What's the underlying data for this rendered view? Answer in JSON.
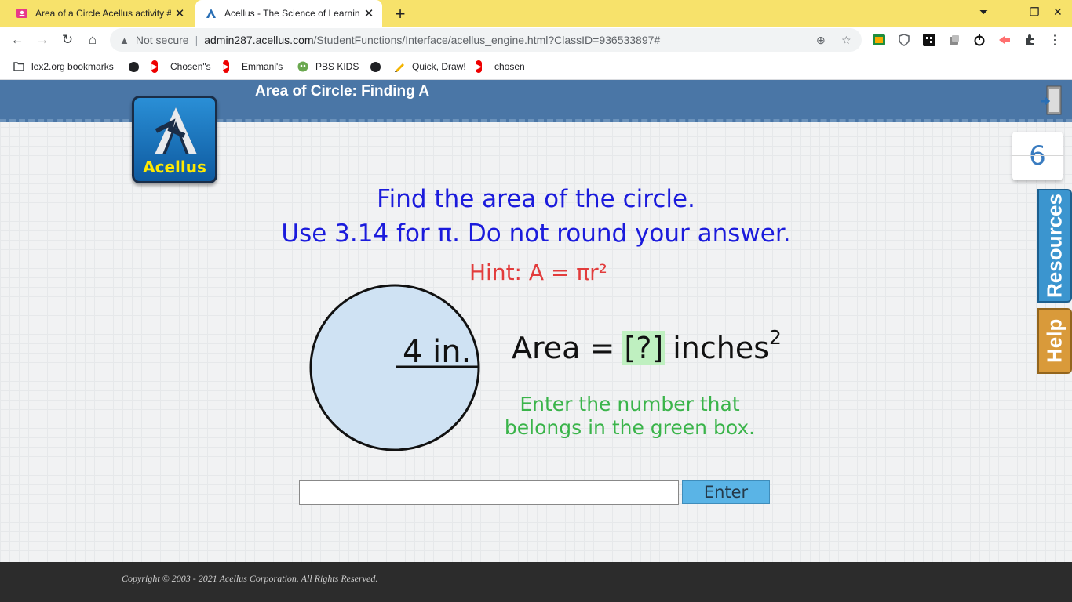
{
  "tabs": [
    {
      "title": "Area of a Circle Acellus activity #"
    },
    {
      "title": "Acellus - The Science of Learning"
    }
  ],
  "address_bar": {
    "security": "Not secure",
    "host": "admin287.acellus.com",
    "path": "/StudentFunctions/Interface/acellus_engine.html?ClassID=936533897#"
  },
  "bookmarks": [
    {
      "label": "lex2.org bookmarks",
      "icon": "folder-icon"
    },
    {
      "label": "",
      "icon": "globe-icon"
    },
    {
      "label": "Chosen\"s",
      "icon": "youtube-icon"
    },
    {
      "label": "Emmani's",
      "icon": "youtube-icon"
    },
    {
      "label": "PBS KIDS",
      "icon": "pbs-kids-icon"
    },
    {
      "label": "",
      "icon": "globe-icon"
    },
    {
      "label": "Quick, Draw!",
      "icon": "quick-draw-icon"
    },
    {
      "label": "chosen",
      "icon": "youtube-icon"
    }
  ],
  "lesson": {
    "title": "Area of Circle: Finding A",
    "logo_label": "Acellus",
    "problem_counter": "6",
    "resources_label": "Resources",
    "help_label": "Help"
  },
  "problem": {
    "line1": "Find the area of the circle.",
    "line2": "Use 3.14 for π. Do not round your answer.",
    "hint": "Hint:  A = πr²",
    "radius_label": "4 in.",
    "area_prefix": "Area =",
    "area_box": "[?]",
    "area_unit": "inches",
    "area_exponent": "2",
    "instruction": "Enter the number that belongs in the green box."
  },
  "answer": {
    "value": "",
    "button_label": "Enter"
  },
  "footer": {
    "copyright": "Copyright © 2003 - 2021 Acellus Corporation.  All Rights Reserved."
  },
  "colors": {
    "banner": "#4a76a6",
    "question": "#1b1bdc",
    "hint": "#e23c3c",
    "instruction": "#3ab44a",
    "green_box": "#bff0c0",
    "circle_fill": "#cfe2f3"
  }
}
